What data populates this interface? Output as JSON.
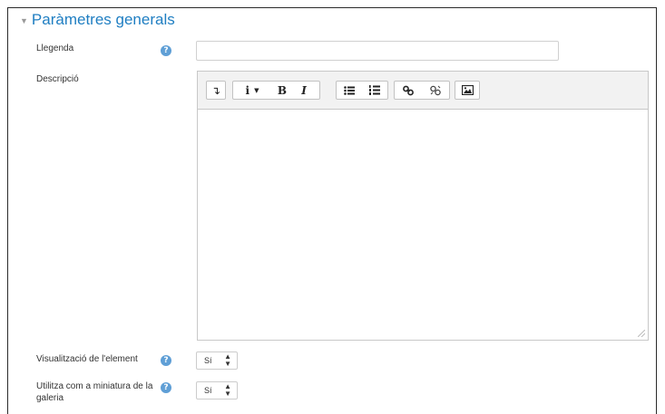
{
  "section": {
    "title": "Paràmetres generals",
    "caret_icon": "caret-down-icon"
  },
  "fields": {
    "caption": {
      "label": "Llegenda",
      "value": "",
      "placeholder": ""
    },
    "description": {
      "label": "Descripció",
      "content": ""
    },
    "visibility": {
      "label": "Visualització de l'element",
      "value": "Sí"
    },
    "thumbnail": {
      "label": "Utilitza com a miniatura de la galeria",
      "value": "Sí"
    }
  },
  "toolbar": {
    "buttons": [
      "collapse-toolbar",
      "info-dropdown",
      "bold",
      "italic",
      "unordered-list",
      "ordered-list",
      "link",
      "unlink",
      "image"
    ],
    "bold_label": "B",
    "italic_label": "I",
    "info_label": "i"
  },
  "colors": {
    "accent": "#1f7ec2",
    "help": "#5f9fd6",
    "toolbar_bg": "#f2f2f2"
  }
}
